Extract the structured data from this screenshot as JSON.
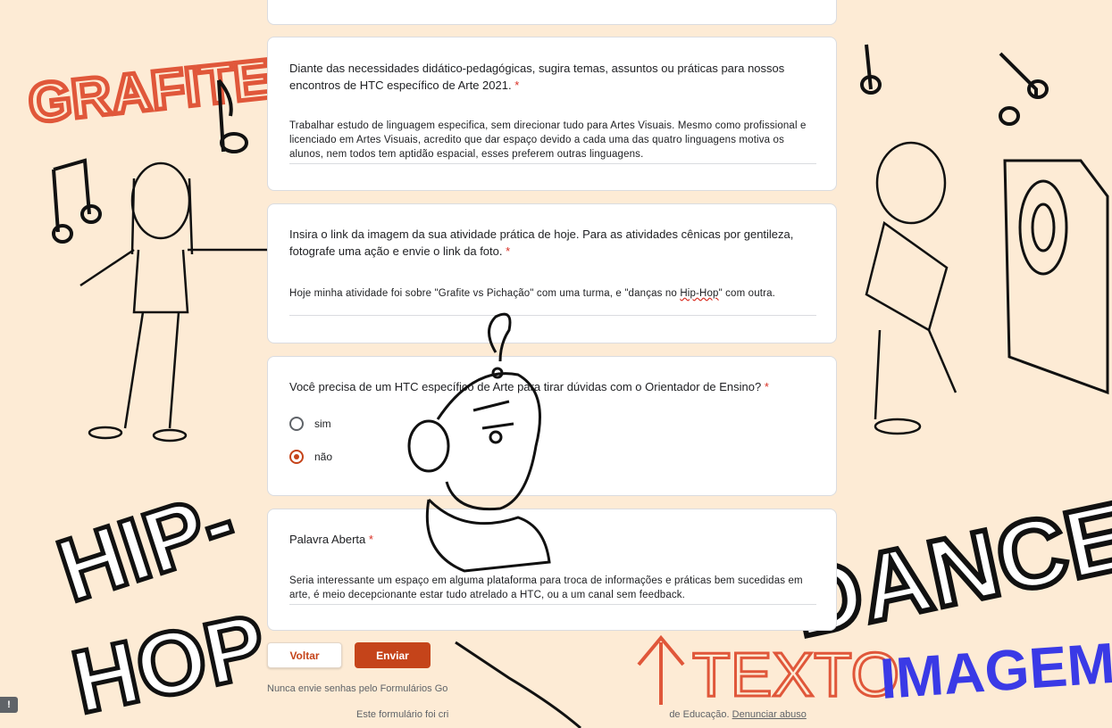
{
  "questions": [
    {
      "title": "Diante das necessidades didático-pedagógicas, sugira temas, assuntos ou práticas para nossos encontros de HTC específico de Arte 2021.",
      "required_mark": "*",
      "answer": "Trabalhar estudo de  linguagem especifica, sem direcionar tudo para Artes Visuais. Mesmo como profissional e licenciado em Artes Visuais, acredito que dar espaço devido a cada uma das quatro linguagens motiva os alunos, nem todos tem aptidão espacial, esses preferem outras linguagens."
    },
    {
      "title": "Insira o link da imagem da sua atividade prática de hoje. Para as atividades cênicas por gentileza, fotografe uma ação e envie o link da foto.",
      "required_mark": "*",
      "answer_part1": "Hoje minha atividade foi sobre \"Grafite vs Pichação\" com uma turma, e \"danças no ",
      "answer_wavy": "Hip-Hop",
      "answer_part2": "\" com outra."
    },
    {
      "title": "Você precisa de um HTC específico de Arte para tirar dúvidas com o Orientador de Ensino?",
      "required_mark": "*",
      "options": [
        {
          "label": "sim",
          "checked": false
        },
        {
          "label": "não",
          "checked": true
        }
      ]
    },
    {
      "title": "Palavra Aberta",
      "required_mark": "*",
      "answer": "Seria interessante um espaço em alguma plataforma para troca de informações e práticas bem sucedidas em arte, é meio decepcionante estar tudo atrelado a HTC, ou a um canal sem feedback."
    }
  ],
  "buttons": {
    "back": "Voltar",
    "submit": "Enviar"
  },
  "footer": {
    "note": "Nunca envie senhas pelo Formulários Go",
    "created_prefix": "Este formulário foi cri",
    "created_suffix": "de Educação.",
    "report_link": "Denunciar abuso"
  },
  "report_icon": "!",
  "doodle_words": {
    "grafite": "GRAFITE",
    "hip": "HIP-",
    "hop": "HOP",
    "dance": "DANCE",
    "texto": "TEXTO",
    "imagem": "IMAGEM"
  },
  "colors": {
    "background": "#fdebd5",
    "accent": "#c5441a",
    "required": "#d93025"
  }
}
